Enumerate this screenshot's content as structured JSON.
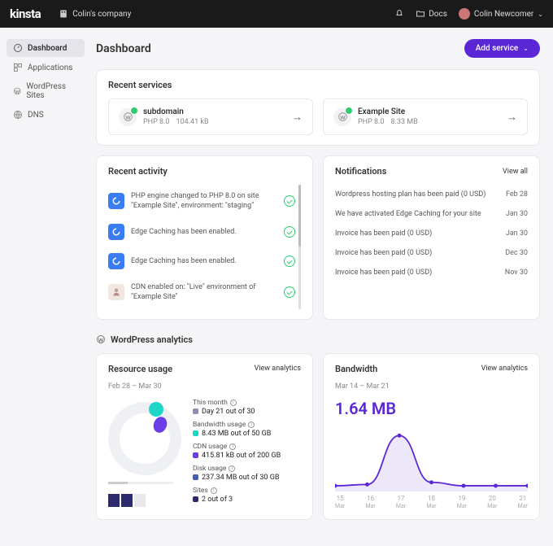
{
  "topbar": {
    "logo": "kinsta",
    "company": "Colin's company",
    "docs_label": "Docs",
    "user_name": "Colin Newcomer"
  },
  "sidebar": {
    "items": [
      {
        "label": "Dashboard",
        "icon": "gauge-icon",
        "active": true
      },
      {
        "label": "Applications",
        "icon": "apps-icon"
      },
      {
        "label": "WordPress Sites",
        "icon": "wordpress-icon"
      },
      {
        "label": "DNS",
        "icon": "dns-icon"
      }
    ]
  },
  "page": {
    "title": "Dashboard",
    "add_service_label": "Add service"
  },
  "recent_services": {
    "title": "Recent services",
    "items": [
      {
        "name": "subdomain",
        "php": "PHP 8.0",
        "size": "104.41 kB"
      },
      {
        "name": "Example Site",
        "php": "PHP 8.0",
        "size": "8.33 MB"
      }
    ]
  },
  "recent_activity": {
    "title": "Recent activity",
    "items": [
      {
        "text": "PHP engine changed to PHP 8.0 on site \"Example Site\", environment: \"staging\"",
        "icon": "blue"
      },
      {
        "text": "Edge Caching has been enabled.",
        "icon": "blue"
      },
      {
        "text": "Edge Caching has been enabled.",
        "icon": "blue"
      },
      {
        "text": "CDN enabled on: \"Live\" environment of \"Example Site\"",
        "icon": "person"
      }
    ]
  },
  "notifications": {
    "title": "Notifications",
    "view_all": "View all",
    "items": [
      {
        "text": "Wordpress hosting plan has been paid (0 USD)",
        "date": "Feb 28"
      },
      {
        "text": "We have activated Edge Caching for your site",
        "date": "Jan 30"
      },
      {
        "text": "Invoice has been paid (0 USD)",
        "date": "Jan 30"
      },
      {
        "text": "Invoice has been paid (0 USD)",
        "date": "Dec 30"
      },
      {
        "text": "Invoice has been paid (0 USD)",
        "date": "Nov 30"
      }
    ]
  },
  "analytics_section": {
    "title": "WordPress analytics"
  },
  "resource_usage": {
    "title": "Resource usage",
    "view_link": "View analytics",
    "date_range": "Feb 28 – Mar 30",
    "items": [
      {
        "label": "This month",
        "value": "Day 21 out of 30",
        "color": "#8e8eb5"
      },
      {
        "label": "Bandwidth usage",
        "value": "8.43 MB out of 50 GB",
        "color": "#1dd6c8"
      },
      {
        "label": "CDN usage",
        "value": "415.81 kB out of 200 GB",
        "color": "#6b3ce8"
      },
      {
        "label": "Disk usage",
        "value": "237.34 MB out of 30 GB",
        "color": "#4060b8"
      },
      {
        "label": "Sites",
        "value": "2 out of 3",
        "color": "#2d2a6e"
      }
    ]
  },
  "bandwidth": {
    "title": "Bandwidth",
    "view_link": "View analytics",
    "date_range": "Mar 14 – Mar 21",
    "total": "1.64 MB"
  },
  "chart_data": {
    "type": "area",
    "title": "Bandwidth",
    "ylabel": "",
    "xlabel": "Mar",
    "x": [
      15,
      16,
      17,
      18,
      19,
      20,
      21
    ],
    "series": [
      {
        "name": "Bandwidth",
        "values": [
          0.02,
          0.05,
          1.2,
          0.1,
          0.02,
          0.02,
          0.02
        ]
      }
    ],
    "ylim": [
      0,
      1.3
    ],
    "color": "#5a26d6"
  }
}
